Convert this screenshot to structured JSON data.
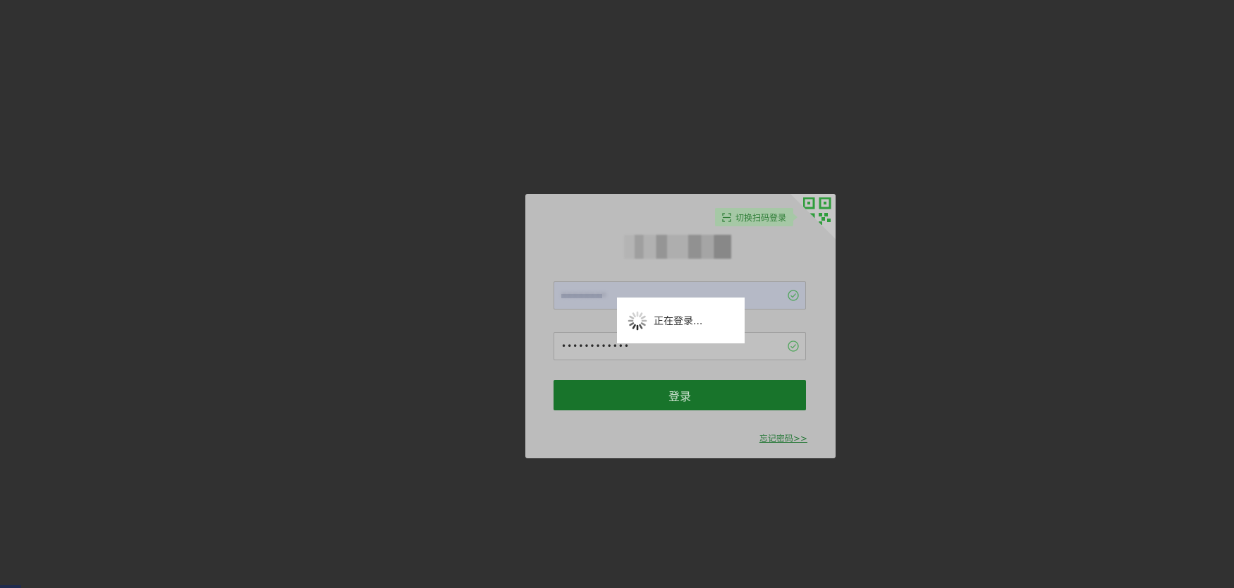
{
  "login_card": {
    "qr_switch_label": "切换扫码登录",
    "account_value": "••••••••",
    "password_value": "••••••••••••",
    "login_button_label": "登录",
    "forgot_password_link": "忘记密码>>"
  },
  "loading": {
    "text": "正在登录..."
  },
  "colors": {
    "page_background": "#313131",
    "brand_green": "#18742b",
    "success_check": "#4ea55a"
  },
  "icons": {
    "qr": "qr-code-icon",
    "scan": "scan-icon",
    "check": "check-circle-icon",
    "spinner": "spinner-icon"
  }
}
